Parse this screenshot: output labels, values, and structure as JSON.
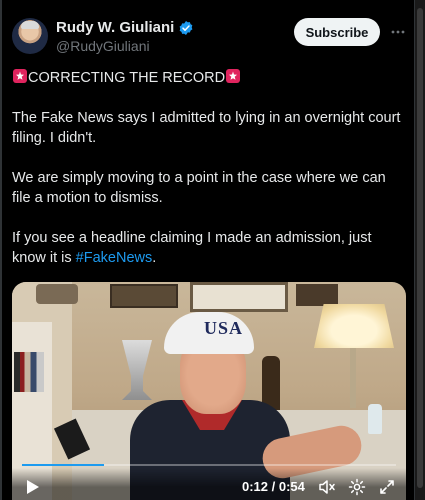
{
  "author": {
    "display_name": "Rudy W. Giuliani",
    "handle": "@RudyGiuliani",
    "verified_icon": "verified-badge-icon"
  },
  "actions": {
    "subscribe_label": "Subscribe",
    "more_icon": "more-options-icon"
  },
  "tweet": {
    "headline": "CORRECTING THE RECORD",
    "paragraph_1": "The Fake News says I admitted to lying in an overnight court filing. I didn't.",
    "paragraph_2": "We are simply moving to a point in the case where we can file a motion to dismiss.",
    "paragraph_3_prefix": "If you see a headline claiming I made an admission, just know it is ",
    "hashtag": "#FakeNews",
    "paragraph_3_suffix": "."
  },
  "video": {
    "cap_text": "USA",
    "time_display": "0:12 / 0:54",
    "progress": 0.22,
    "icons": [
      "play-icon",
      "mute-icon",
      "settings-icon",
      "fullscreen-icon"
    ]
  },
  "colors": {
    "background": "#000000",
    "text": "#e7e9ea",
    "secondary_text": "#71767b",
    "hashtag": "#1d9bf0",
    "verified": "#1d9bf0",
    "siren": "#e0245e"
  }
}
